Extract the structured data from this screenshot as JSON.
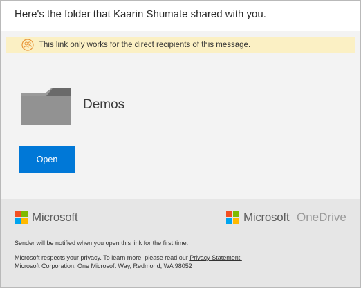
{
  "header": {
    "title": "Here's the folder that Kaarin Shumate shared with you."
  },
  "notice": {
    "icon": "shared-people-icon",
    "text": "This link only works for the direct recipients of this message."
  },
  "folder": {
    "icon": "folder-icon",
    "name": "Demos"
  },
  "open_button": {
    "label": "Open",
    "color": "#0078d7"
  },
  "footer": {
    "left_logo": "Microsoft",
    "right_logo_brand": "Microsoft",
    "right_logo_product": "OneDrive",
    "notify_text": "Sender will be notified when you open this link for the first time.",
    "privacy_prefix": "Microsoft respects your privacy. To learn more, please read our ",
    "privacy_link": "Privacy Statement.",
    "address": "Microsoft Corporation, One Microsoft Way, Redmond, WA 98052"
  }
}
